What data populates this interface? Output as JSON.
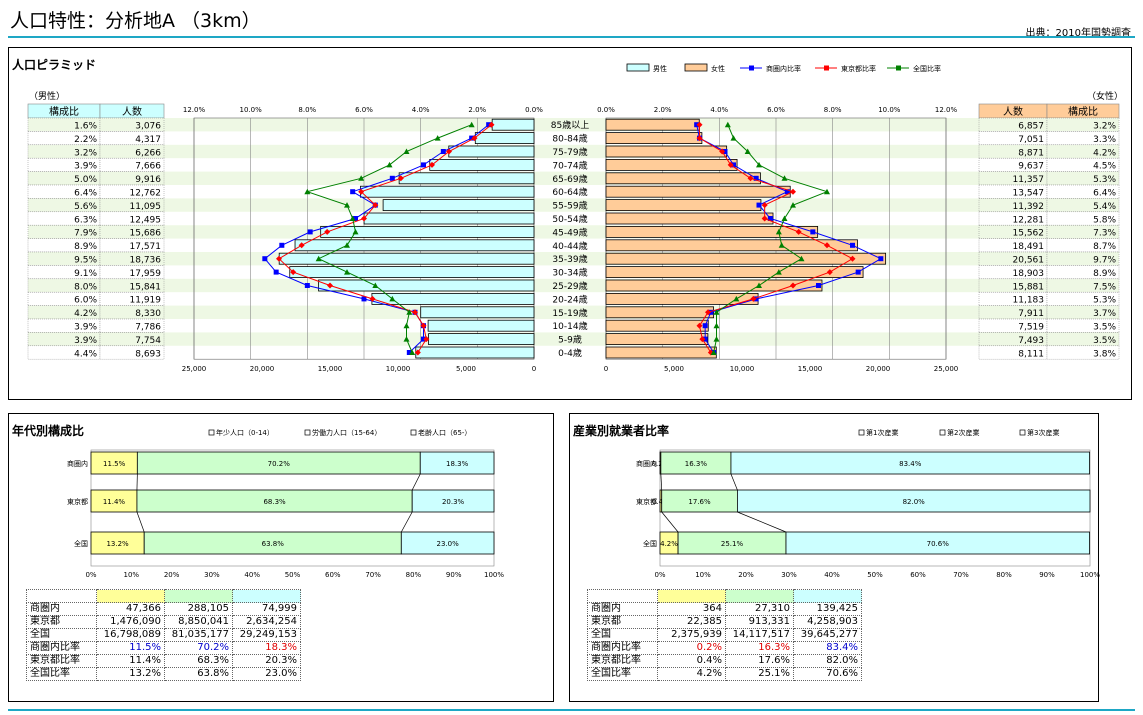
{
  "header": {
    "title": "人口特性：分析地A （3km）",
    "source": "出典：2010年国勢調査"
  },
  "pyramid": {
    "title": "人口ピラミッド",
    "male_label": "（男性）",
    "female_label": "（女性）",
    "col_ratio": "構成比",
    "col_count": "人数",
    "legend": [
      "男性",
      "女性",
      "商圏内比率",
      "東京都比率",
      "全国比率"
    ],
    "colors": {
      "male": "#ccffff",
      "female": "#ffcc99",
      "area": "#0000ff",
      "tokyo": "#ff0000",
      "japan": "#008000"
    },
    "pct_ticks": [
      "12.0%",
      "10.0%",
      "8.0%",
      "6.0%",
      "4.0%",
      "2.0%",
      "0.0%"
    ],
    "pct_ticks_r": [
      "0.0%",
      "2.0%",
      "4.0%",
      "6.0%",
      "8.0%",
      "10.0%",
      "12.0%"
    ],
    "count_ticks": [
      "25,000",
      "20,000",
      "15,000",
      "10,000",
      "5,000",
      "0"
    ],
    "count_ticks_r": [
      "0",
      "5,000",
      "10,000",
      "15,000",
      "20,000",
      "25,000"
    ],
    "age_groups": [
      "85歳以上",
      "80-84歳",
      "75-79歳",
      "70-74歳",
      "65-69歳",
      "60-64歳",
      "55-59歳",
      "50-54歳",
      "45-49歳",
      "40-44歳",
      "35-39歳",
      "30-34歳",
      "25-29歳",
      "20-24歳",
      "15-19歳",
      "10-14歳",
      "5-9歳",
      "0-4歳"
    ],
    "male_ratio": [
      "1.6%",
      "2.2%",
      "3.2%",
      "3.9%",
      "5.0%",
      "6.4%",
      "5.6%",
      "6.3%",
      "7.9%",
      "8.9%",
      "9.5%",
      "9.1%",
      "8.0%",
      "6.0%",
      "4.2%",
      "3.9%",
      "3.9%",
      "4.4%"
    ],
    "male_count_text": [
      "3,076",
      "4,317",
      "6,266",
      "7,666",
      "9,916",
      "12,762",
      "11,095",
      "12,495",
      "15,686",
      "17,571",
      "18,736",
      "17,959",
      "15,841",
      "11,919",
      "8,330",
      "7,786",
      "7,754",
      "8,693"
    ],
    "female_count_text": [
      "6,857",
      "7,051",
      "8,871",
      "9,637",
      "11,357",
      "13,547",
      "11,392",
      "12,281",
      "15,562",
      "18,491",
      "20,561",
      "18,903",
      "15,881",
      "11,183",
      "7,911",
      "7,519",
      "7,493",
      "8,111"
    ],
    "female_ratio": [
      "3.2%",
      "3.3%",
      "4.2%",
      "4.5%",
      "5.3%",
      "6.4%",
      "5.4%",
      "5.8%",
      "7.3%",
      "8.7%",
      "9.7%",
      "8.9%",
      "7.5%",
      "5.3%",
      "3.7%",
      "3.5%",
      "3.5%",
      "3.8%"
    ]
  },
  "chart_data": [
    {
      "type": "bar",
      "title": "人口ピラミッド",
      "categories": [
        "85歳以上",
        "80-84歳",
        "75-79歳",
        "70-74歳",
        "65-69歳",
        "60-64歳",
        "55-59歳",
        "50-54歳",
        "45-49歳",
        "40-44歳",
        "35-39歳",
        "30-34歳",
        "25-29歳",
        "20-24歳",
        "15-19歳",
        "10-14歳",
        "5-9歳",
        "0-4歳"
      ],
      "xlim": [
        0,
        25000
      ],
      "pct_lim": [
        0,
        12
      ],
      "series": [
        {
          "name": "男性",
          "values": [
            3076,
            4317,
            6266,
            7666,
            9916,
            12762,
            11095,
            12495,
            15686,
            17571,
            18736,
            17959,
            15841,
            11919,
            8330,
            7786,
            7754,
            8693
          ]
        },
        {
          "name": "女性",
          "values": [
            6857,
            7051,
            8871,
            9637,
            11357,
            13547,
            11392,
            12281,
            15562,
            18491,
            20561,
            18903,
            15881,
            11183,
            7911,
            7519,
            7493,
            8111
          ]
        }
      ],
      "lines_male": [
        {
          "name": "商圏内比率",
          "values": [
            1.6,
            2.2,
            3.2,
            3.9,
            5.0,
            6.4,
            5.6,
            6.3,
            7.9,
            8.9,
            9.5,
            9.1,
            8.0,
            6.0,
            4.2,
            3.9,
            3.9,
            4.4
          ]
        },
        {
          "name": "東京都比率",
          "values": [
            1.5,
            2.1,
            3.0,
            3.6,
            4.7,
            6.1,
            5.6,
            6.0,
            7.3,
            8.2,
            9.0,
            8.5,
            7.2,
            5.7,
            4.2,
            3.9,
            3.8,
            4.1
          ]
        },
        {
          "name": "全国比率",
          "values": [
            2.2,
            3.4,
            4.5,
            5.1,
            6.1,
            8.0,
            6.6,
            6.4,
            6.3,
            6.6,
            7.6,
            6.6,
            5.6,
            5.0,
            4.4,
            4.5,
            4.5,
            4.3
          ]
        }
      ],
      "lines_female": [
        {
          "name": "商圏内比率",
          "values": [
            3.2,
            3.3,
            4.2,
            4.5,
            5.3,
            6.4,
            5.4,
            5.8,
            7.3,
            8.7,
            9.7,
            8.9,
            7.5,
            5.3,
            3.7,
            3.5,
            3.5,
            3.8
          ]
        },
        {
          "name": "東京都比率",
          "values": [
            3.3,
            3.3,
            4.1,
            4.4,
            5.1,
            6.6,
            5.6,
            5.6,
            6.8,
            7.8,
            8.7,
            7.9,
            6.6,
            5.2,
            3.6,
            3.3,
            3.4,
            3.7
          ]
        },
        {
          "name": "全国比率",
          "values": [
            4.3,
            4.5,
            5.0,
            5.4,
            6.3,
            7.8,
            6.6,
            6.3,
            6.1,
            6.2,
            6.9,
            6.1,
            5.4,
            4.6,
            3.9,
            3.9,
            3.9,
            3.8
          ]
        }
      ]
    },
    {
      "type": "bar",
      "title": "年代別構成比",
      "categories": [
        "商圏内",
        "東京都",
        "全国"
      ],
      "series": [
        {
          "name": "年少人口（0-14）",
          "values": [
            11.5,
            11.4,
            13.2
          ]
        },
        {
          "name": "労働力人口（15-64）",
          "values": [
            70.2,
            68.3,
            63.8
          ]
        },
        {
          "name": "老齢人口（65-）",
          "values": [
            18.3,
            20.3,
            23.0
          ]
        }
      ],
      "xlim": [
        0,
        100
      ]
    },
    {
      "type": "bar",
      "title": "産業別就業者比率",
      "categories": [
        "商圏内",
        "東京都",
        "全国"
      ],
      "series": [
        {
          "name": "第1次産業",
          "values": [
            0.2,
            0.4,
            4.2
          ]
        },
        {
          "name": "第2次産業",
          "values": [
            16.3,
            17.6,
            25.1
          ]
        },
        {
          "name": "第3次産業",
          "values": [
            83.4,
            82.0,
            70.6
          ]
        }
      ],
      "xlim": [
        0,
        100
      ]
    }
  ],
  "age_panel": {
    "title": "年代別構成比",
    "legend": [
      "年少人口（0-14）",
      "労働力人口（15-64）",
      "老齢人口（65-）"
    ],
    "colors": [
      "#ffff99",
      "#ccffcc",
      "#ccffff"
    ],
    "categories": [
      "商圏内",
      "東京都",
      "全国"
    ],
    "labels": [
      [
        "11.5%",
        "70.2%",
        "18.3%"
      ],
      [
        "11.4%",
        "68.3%",
        "20.3%"
      ],
      [
        "13.2%",
        "63.8%",
        "23.0%"
      ]
    ],
    "ticks": [
      "0%",
      "10%",
      "20%",
      "30%",
      "40%",
      "50%",
      "60%",
      "70%",
      "80%",
      "90%",
      "100%"
    ],
    "table": [
      [
        "商圏内",
        "47,366",
        "288,105",
        "74,999"
      ],
      [
        "東京都",
        "1,476,090",
        "8,850,041",
        "2,634,254"
      ],
      [
        "全国",
        "16,798,089",
        "81,035,177",
        "29,249,153"
      ],
      [
        "商圏内比率",
        "11.5%",
        "70.2%",
        "18.3%"
      ],
      [
        "東京都比率",
        "11.4%",
        "68.3%",
        "20.3%"
      ],
      [
        "全国比率",
        "13.2%",
        "63.8%",
        "23.0%"
      ]
    ]
  },
  "ind_panel": {
    "title": "産業別就業者比率",
    "legend": [
      "第1次産業",
      "第2次産業",
      "第3次産業"
    ],
    "colors": [
      "#ffff99",
      "#ccffcc",
      "#ccffff"
    ],
    "categories": [
      "商圏内",
      "東京都",
      "全国"
    ],
    "labels": [
      [
        "0.2%",
        "16.3%",
        "83.4%"
      ],
      [
        "0.4%",
        "17.6%",
        "82.0%"
      ],
      [
        "4.2%",
        "25.1%",
        "70.6%"
      ]
    ],
    "ticks": [
      "0%",
      "10%",
      "20%",
      "30%",
      "40%",
      "50%",
      "60%",
      "70%",
      "80%",
      "90%",
      "100%"
    ],
    "table": [
      [
        "商圏内",
        "364",
        "27,310",
        "139,425"
      ],
      [
        "東京都",
        "22,385",
        "913,331",
        "4,258,903"
      ],
      [
        "全国",
        "2,375,939",
        "14,117,517",
        "39,645,277"
      ],
      [
        "商圏内比率",
        "0.2%",
        "16.3%",
        "83.4%"
      ],
      [
        "東京都比率",
        "0.4%",
        "17.6%",
        "82.0%"
      ],
      [
        "全国比率",
        "4.2%",
        "25.1%",
        "70.6%"
      ]
    ]
  }
}
